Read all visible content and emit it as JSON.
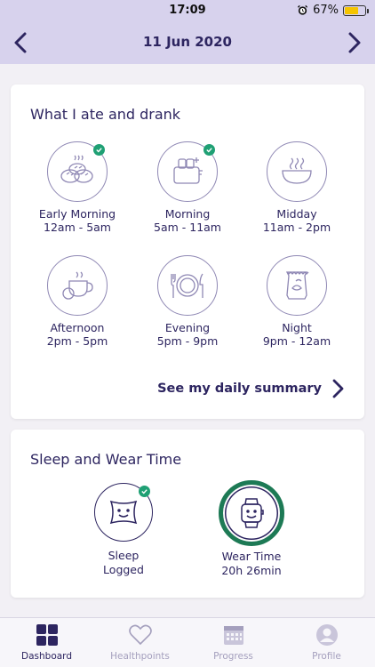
{
  "status_bar": {
    "time": "17:09",
    "battery": "67%",
    "battery_level": 0.67
  },
  "header": {
    "date": "11 Jun 2020"
  },
  "food_card": {
    "title": "What I ate and drank",
    "meals": [
      {
        "name": "Early Morning",
        "range": "12am - 5am",
        "logged": true
      },
      {
        "name": "Morning",
        "range": "5am - 11am",
        "logged": true
      },
      {
        "name": "Midday",
        "range": "11am - 2pm",
        "logged": false
      },
      {
        "name": "Afternoon",
        "range": "2pm - 5pm",
        "logged": false
      },
      {
        "name": "Evening",
        "range": "5pm - 9pm",
        "logged": false
      },
      {
        "name": "Night",
        "range": "9pm - 12am",
        "logged": false
      }
    ],
    "summary_link": "See my daily summary"
  },
  "sleep_card": {
    "title": "Sleep and Wear Time",
    "sleep": {
      "line1": "Sleep",
      "line2": "Logged"
    },
    "wear": {
      "line1": "Wear Time",
      "line2": "20h 26min"
    }
  },
  "tabs": [
    {
      "label": "Dashboard",
      "active": true
    },
    {
      "label": "Healthpoints",
      "active": false
    },
    {
      "label": "Progress",
      "active": false
    },
    {
      "label": "Profile",
      "active": false
    }
  ],
  "colors": {
    "primary": "#2d2560",
    "header_bg": "#d7d2ed",
    "check_green": "#1fa074",
    "wear_green": "#1d7a55"
  }
}
